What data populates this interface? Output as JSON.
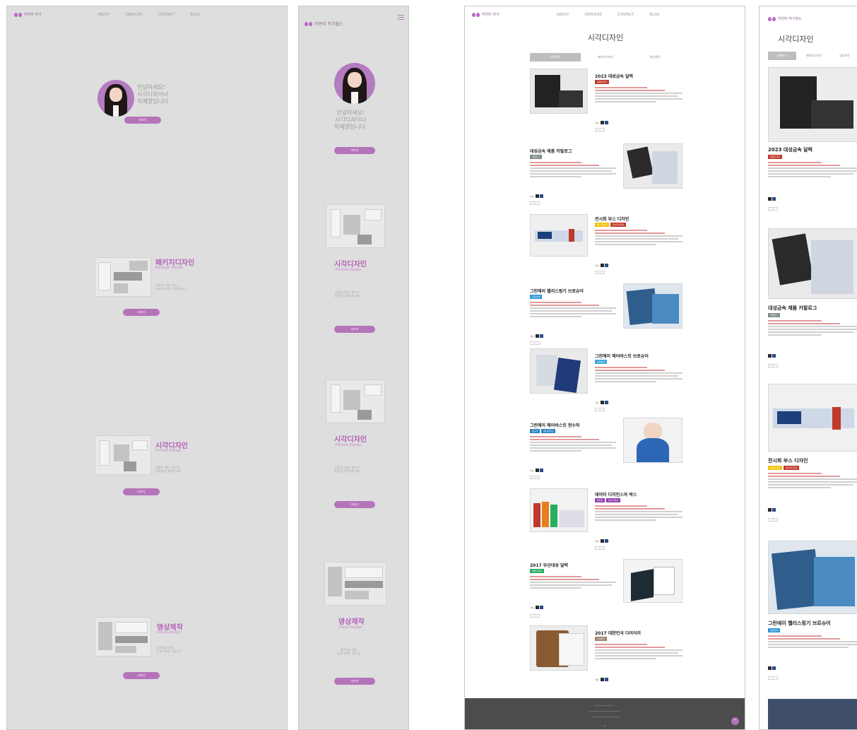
{
  "brand": {
    "accent": "#b574ba",
    "name_short": "하얀미 작가"
  },
  "desktop_intro": {
    "nav": [
      "ABOUT",
      "SERVICES",
      "CONTACT",
      "BLOG"
    ],
    "greeting": [
      "안녕하세요!",
      "시각디자이너",
      "하예영입니다."
    ],
    "intro_button": "더보기",
    "services": [
      {
        "title": "패키지디자인",
        "subtitle": "Package Design",
        "desc": [
          "포장재, 라벨, 박스",
          "패키지 디자인 작업입니다"
        ],
        "button": "더보기"
      },
      {
        "title": "시각디자인",
        "subtitle": "Printed Design",
        "desc": [
          "리플렛, 배너, 현수막",
          "편집물 및 홍보물 제작"
        ],
        "button": "더보기"
      },
      {
        "title": "영상제작",
        "subtitle": "Visual Design",
        "desc": [
          "홍보영상 제작",
          "모션그래픽, 편집 등"
        ],
        "button": "더보기"
      }
    ]
  },
  "mobile_intro": {
    "brand": "하얀미 작가월드",
    "greeting": [
      "안녕하세요!",
      "시각디자이너",
      "하예영입니다."
    ],
    "intro_button": "더보기",
    "services": [
      {
        "title": "시각디자인",
        "subtitle": "Printed Design",
        "desc": [
          "리플렛, 배너, 현수막",
          "편집물 및 홍보물 제작"
        ],
        "button": "더보기"
      },
      {
        "title": "시각디자인",
        "subtitle": "Printed Design",
        "desc": [
          "리플렛, 배너, 현수막",
          "편집물 및 홍보물 제작"
        ],
        "button": "더보기"
      },
      {
        "title": "영상제작",
        "subtitle": "Visual Design",
        "desc": [
          "홍보영상 제작",
          "모션그래픽, 편집 등"
        ],
        "button": "더보기"
      }
    ]
  },
  "portfolio": {
    "nav": [
      "ABOUT",
      "SERVICES",
      "CONTACT",
      "BLOG"
    ],
    "title": "시각디자인",
    "tabs": [
      "전체보기",
      "패키지디자인",
      "영상제작"
    ],
    "items": [
      {
        "title": "2023 대성금속 달력",
        "badges": [
          {
            "text": "달력디자인",
            "color": "#c0392b"
          }
        ],
        "swatch_label": "색상",
        "colors": [
          "#2b2b2b",
          "#2c4a86"
        ]
      },
      {
        "title": "대성금속 제품 카탈로그",
        "badges": [
          {
            "text": "카탈로그",
            "color": "#7f8c8d"
          }
        ],
        "swatch_label": "색상",
        "colors": [
          "#2b2b2b",
          "#2c4a86"
        ]
      },
      {
        "title": "전시회 부스 디자인",
        "badges": [
          {
            "text": "부스디자인",
            "color": "#f1c40f"
          },
          {
            "text": "현수막디자인",
            "color": "#c0392b"
          }
        ],
        "swatch_label": "색상",
        "colors": [
          "#2b2b2b",
          "#2c4a86"
        ]
      },
      {
        "title": "그린에이 헬리스핑기 브로슈어",
        "badges": [
          {
            "text": "브로슈어",
            "color": "#3498db"
          }
        ],
        "swatch_label": "색상",
        "colors": [
          "#2b2b2b",
          "#2c4a86"
        ]
      },
      {
        "title": "그린에이 헤어바스킷 브로슈어",
        "badges": [
          {
            "text": "브로슈어",
            "color": "#3aa7d9"
          }
        ],
        "swatch_label": "색상",
        "colors": [
          "#2b2b2b",
          "#2c4a86"
        ]
      },
      {
        "title": "그린에이 헤어바스킷 현수막",
        "badges": [
          {
            "text": "현수막",
            "color": "#2e86c1"
          },
          {
            "text": "배너디자인",
            "color": "#2e86c1"
          }
        ],
        "swatch_label": "색상",
        "colors": [
          "#2b2b2b",
          "#2c4a86"
        ]
      },
      {
        "title": "데이터 디자인스의 박스",
        "badges": [
          {
            "text": "패키지",
            "color": "#8e44ad"
          },
          {
            "text": "박스디자인",
            "color": "#8e44ad"
          }
        ],
        "swatch_label": "색상",
        "colors": [
          "#2b2b2b",
          "#2c4a86"
        ]
      },
      {
        "title": "2017 부산대성 달력",
        "badges": [
          {
            "text": "달력디자인",
            "color": "#27ae60"
          }
        ],
        "swatch_label": "색상",
        "colors": [
          "#2b2b2b",
          "#2c4a86"
        ]
      },
      {
        "title": "2017 대한민국 다이어리",
        "badges": [
          {
            "text": "다이어리",
            "color": "#a0826d"
          }
        ],
        "swatch_label": "색상",
        "colors": [
          "#2b2b2b",
          "#2c4a86"
        ]
      }
    ],
    "more_label": "more"
  },
  "mobile_portfolio": {
    "brand": "하얀미 작가월드",
    "title": "시각디자인",
    "tabs": [
      "전체보기",
      "패키지디자인",
      "영상제작"
    ],
    "items": [
      {
        "title": "2023 대성금속 달력",
        "badges": [
          {
            "text": "달력디자인",
            "color": "#c0392b"
          }
        ]
      },
      {
        "title": "대성금속 제품 카탈로그",
        "badges": [
          {
            "text": "카탈로그",
            "color": "#7f8c8d"
          }
        ]
      },
      {
        "title": "전시회 부스 디자인",
        "badges": [
          {
            "text": "부스디자인",
            "color": "#f1c40f"
          },
          {
            "text": "현수막디자인",
            "color": "#c0392b"
          }
        ]
      },
      {
        "title": "그린에이 헬리스핑기 브로슈어",
        "badges": [
          {
            "text": "브로슈어",
            "color": "#3498db"
          }
        ]
      }
    ]
  }
}
